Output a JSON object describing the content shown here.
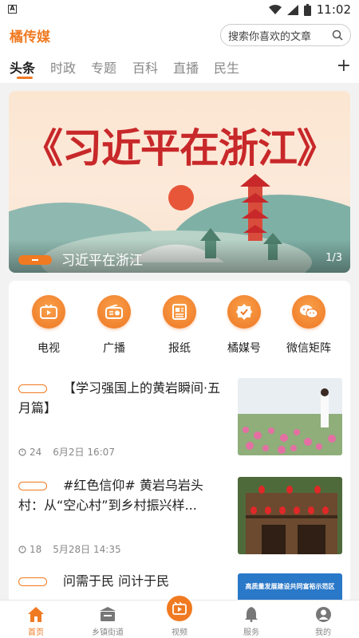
{
  "status_bar": {
    "time": "11:02"
  },
  "header": {
    "app_name": "橘传媒",
    "search_placeholder": "搜索你喜欢的文章"
  },
  "tabs": [
    {
      "label": "头条",
      "active": true
    },
    {
      "label": "时政",
      "active": false
    },
    {
      "label": "专题",
      "active": false
    },
    {
      "label": "百科",
      "active": false
    },
    {
      "label": "直播",
      "active": false
    },
    {
      "label": "民生",
      "active": false
    }
  ],
  "banner": {
    "headline": "《习近平在浙江》",
    "caption": "习近平在浙江",
    "index": "1/3"
  },
  "shortcuts": [
    {
      "label": "电视",
      "icon": "tv-icon"
    },
    {
      "label": "广播",
      "icon": "radio-icon"
    },
    {
      "label": "报纸",
      "icon": "newspaper-icon"
    },
    {
      "label": "橘媒号",
      "icon": "badge-check-icon"
    },
    {
      "label": "微信矩阵",
      "icon": "wechat-icon"
    }
  ],
  "news": [
    {
      "title": "【学习强国上的黄岩瞬间·五月篇】",
      "views": "24",
      "date": "6月2日 16:07"
    },
    {
      "title": "#红色信仰# 黄岩乌岩头村：从“空心村”到乡村振兴样...",
      "views": "18",
      "date": "5月28日 14:35"
    },
    {
      "title": "问需于民 问计于民",
      "thumb_text": "高质量发展建设共同富裕示范区"
    }
  ],
  "bottom_nav": [
    {
      "label": "首页",
      "icon": "home-icon",
      "active": true
    },
    {
      "label": "乡镇街道",
      "icon": "building-icon",
      "active": false
    },
    {
      "label": "视频",
      "icon": "video-icon",
      "active": false
    },
    {
      "label": "服务",
      "icon": "bell-icon",
      "active": false
    },
    {
      "label": "我的",
      "icon": "user-icon",
      "active": false
    }
  ],
  "colors": {
    "accent": "#f07a22",
    "banner_title": "#c8282a"
  }
}
